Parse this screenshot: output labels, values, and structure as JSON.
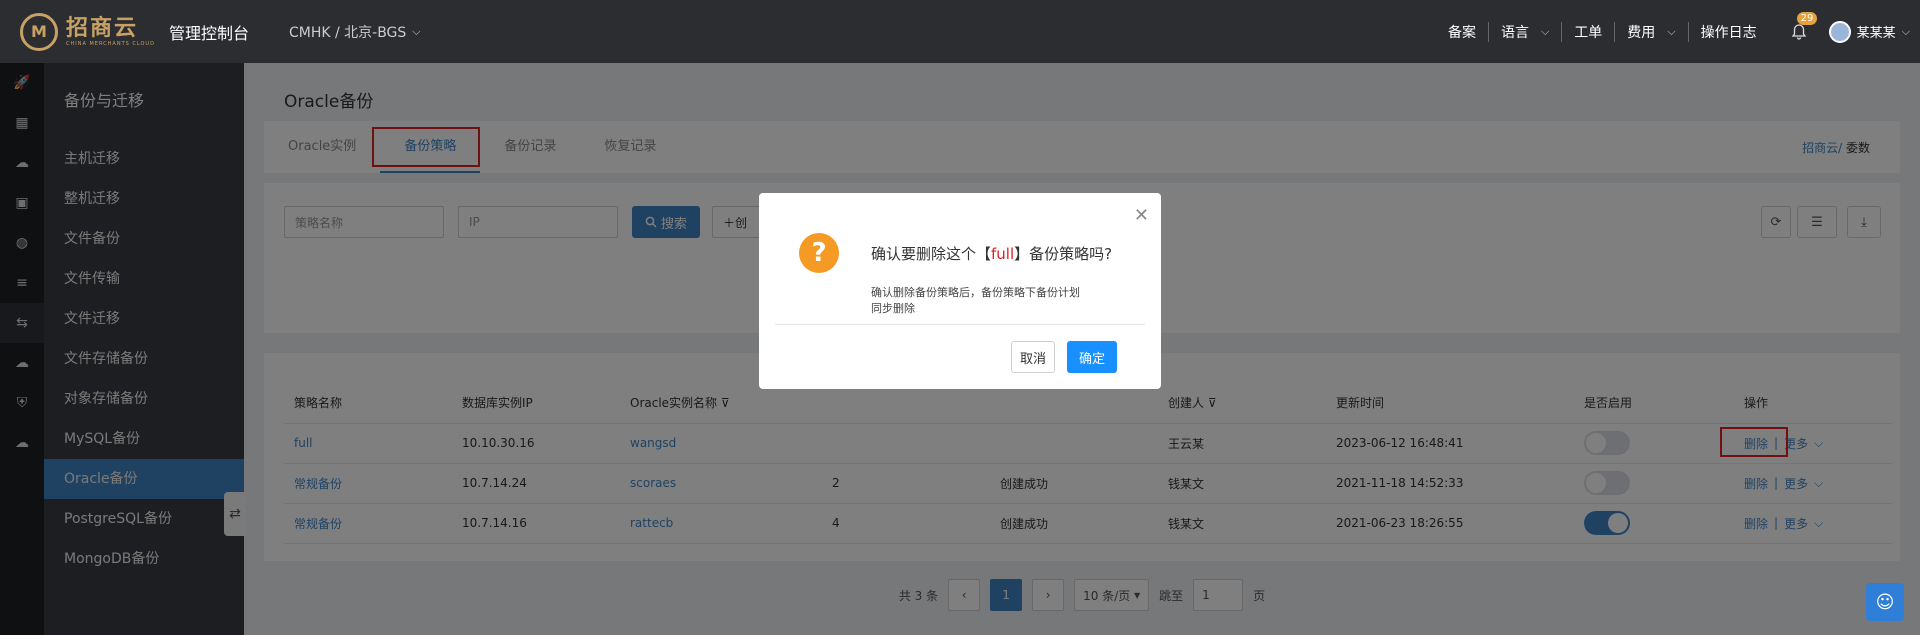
{
  "header": {
    "logo_mark": "M",
    "logo_cn": "招商云",
    "logo_en": "CHINA MERCHANTS CLOUD",
    "console_title": "管理控制台",
    "region": "CMHK / 北京-BGS",
    "nav": [
      "备案",
      "语言",
      "工单",
      "费用",
      "操作日志"
    ],
    "notification_count": "29",
    "user_name": "某某某"
  },
  "sidebar": {
    "title": "备份与迁移",
    "items": [
      "主机迁移",
      "整机迁移",
      "文件备份",
      "文件传输",
      "文件迁移",
      "文件存储备份",
      "对象存储备份",
      "MySQL备份",
      "Oracle备份",
      "PostgreSQL备份",
      "MongoDB备份"
    ],
    "active_index": 8
  },
  "page": {
    "title": "Oracle备份",
    "tabs": [
      "Oracle实例",
      "备份策略",
      "备份记录",
      "恢复记录"
    ],
    "active_tab": 1,
    "breadcrumb_root": "招商云/",
    "breadcrumb_current": "委数"
  },
  "filters": {
    "policy_name_placeholder": "策略名称",
    "ip_placeholder": "IP",
    "search_label": "搜索",
    "create_label": "创"
  },
  "table": {
    "columns": [
      "策略名称",
      "数据库实例IP",
      "Oracle实例名称",
      "",
      "",
      "创建人",
      "更新时间",
      "是否启用",
      "操作"
    ],
    "rows": [
      {
        "name": "full",
        "ip": "10.10.30.16",
        "instance": "wangsd",
        "count": "",
        "status": "",
        "creator": "王云某",
        "updated": "2023-06-12 16:48:41",
        "enabled": false
      },
      {
        "name": "常规备份",
        "ip": "10.7.14.24",
        "instance": "scoraes",
        "count": "2",
        "status": "创建成功",
        "creator": "钱某文",
        "updated": "2021-11-18 14:52:33",
        "enabled": false
      },
      {
        "name": "常规备份",
        "ip": "10.7.14.16",
        "instance": "rattecb",
        "count": "4",
        "status": "创建成功",
        "creator": "钱某文",
        "updated": "2021-06-23 18:26:55",
        "enabled": true
      }
    ],
    "delete_label": "删除",
    "more_label": "更多"
  },
  "pagination": {
    "total": "共 3 条",
    "current": "1",
    "page_size": "10 条/页",
    "goto_label": "跳至",
    "goto_value": "1",
    "page_suffix": "页"
  },
  "modal": {
    "title_prefix": "确认要删除这个【",
    "title_highlight": "full",
    "title_suffix": "】备份策略吗?",
    "message": "确认删除备份策略后，备份策略下备份计划同步删除",
    "cancel_label": "取消",
    "confirm_label": "确定"
  },
  "colors": {
    "accent": "#3f84c6",
    "highlight": "#e02020",
    "warning": "#f59a23"
  }
}
